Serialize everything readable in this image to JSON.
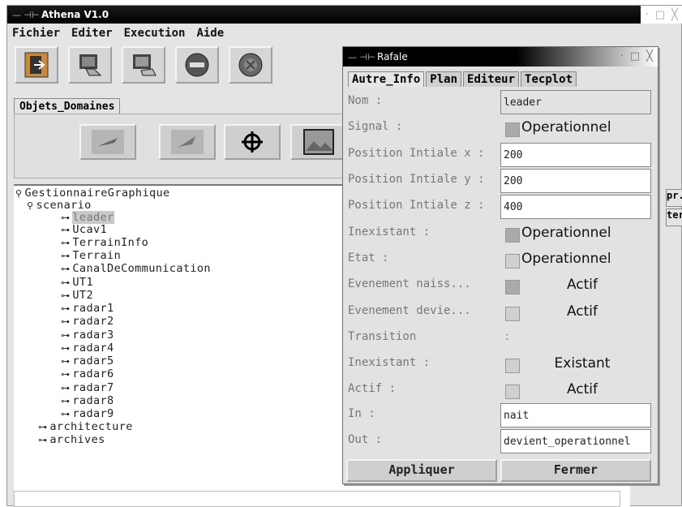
{
  "main_window": {
    "title": "Athena V1.0",
    "title_symbols": "— ⊣⊢",
    "controls": [
      "·",
      "□",
      "╳"
    ]
  },
  "menu": [
    "Fichier",
    "Editer",
    "Execution",
    "Aide"
  ],
  "toolbar_icons": [
    "exit-door-icon",
    "computer-hand-icon",
    "computer-hand-icon",
    "minus-circle-icon",
    "stop-circle-icon"
  ],
  "objets_tab": "Objets_Domaines",
  "objets_icons": [
    "aircraft-icon",
    "jet-icon",
    "crosshair-icon",
    "terrain-map-icon"
  ],
  "right_buttons": [
    "pr.",
    "ter"
  ],
  "tree": {
    "root": "GestionnaireGraphique",
    "scenario": "scenario",
    "items": [
      "leader",
      "Ucav1",
      "TerrainInfo",
      "Terrain",
      "CanalDeCommunication",
      "UT1",
      "UT2",
      "radar1",
      "radar2",
      "radar3",
      "radar4",
      "radar5",
      "radar6",
      "radar7",
      "radar8",
      "radar9"
    ],
    "selected": "leader",
    "siblings": [
      "architecture",
      "archives"
    ]
  },
  "dialog": {
    "title": "Rafale",
    "title_symbols": "— ⊣⊢",
    "controls": [
      "·",
      "□",
      "╳"
    ],
    "tabs": [
      "Autre_Info",
      "Plan",
      "Editeur",
      "Tecplot"
    ],
    "active_tab": "Autre_Info",
    "fields": {
      "nom": {
        "label": "Nom :",
        "value": "leader"
      },
      "signal": {
        "label": "Signal :",
        "checkbox_label": "Operationnel"
      },
      "pos_x": {
        "label": "Position Intiale x :",
        "value": "200"
      },
      "pos_y": {
        "label": "Position Intiale y :",
        "value": "200"
      },
      "pos_z": {
        "label": "Position Intiale z :",
        "value": "400"
      },
      "inexistant1": {
        "label": "Inexistant :",
        "checkbox_label": "Operationnel"
      },
      "etat": {
        "label": "Etat :",
        "checkbox_label": "Operationnel"
      },
      "ev_naiss": {
        "label": "Evenement naiss...",
        "checkbox_label": "Actif"
      },
      "ev_devie": {
        "label": "Evenement devie...",
        "checkbox_label": "Actif"
      },
      "transition": {
        "label": "Transition",
        "value": ":"
      },
      "inexistant2": {
        "label": "Inexistant :",
        "checkbox_label": "Existant"
      },
      "actif": {
        "label": "Actif :",
        "checkbox_label": "Actif"
      },
      "in": {
        "label": "In :",
        "value": "nait"
      },
      "out": {
        "label": "Out :",
        "value": "devient_operationnel"
      }
    },
    "buttons": {
      "apply": "Appliquer",
      "close": "Fermer"
    }
  }
}
